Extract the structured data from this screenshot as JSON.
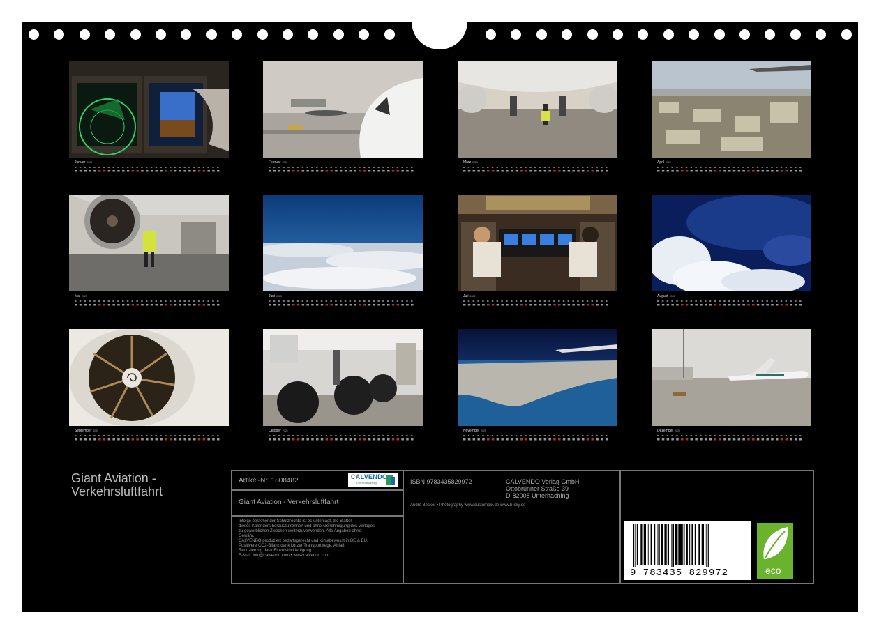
{
  "calendar": {
    "year": "2025",
    "months": [
      {
        "name": "Januar",
        "scene": "cockpit-displays"
      },
      {
        "name": "Februar",
        "scene": "airport-nose"
      },
      {
        "name": "März",
        "scene": "under-aircraft"
      },
      {
        "name": "April",
        "scene": "city-aerial"
      },
      {
        "name": "Mai",
        "scene": "engine-apron"
      },
      {
        "name": "Juni",
        "scene": "above-clouds"
      },
      {
        "name": "Juli",
        "scene": "cockpit-pilots"
      },
      {
        "name": "August",
        "scene": "cumulus"
      },
      {
        "name": "September",
        "scene": "engine-fan"
      },
      {
        "name": "Oktober",
        "scene": "landing-gear"
      },
      {
        "name": "November",
        "scene": "coast-from-altitude"
      },
      {
        "name": "Dezember",
        "scene": "apron-747"
      }
    ]
  },
  "product": {
    "title_line1": "Giant Aviation -",
    "title_line2": "Verkehrsluftfahrt"
  },
  "info": {
    "article": "Artikel-Nr. 1808482",
    "calvendo_logo": "CALVENDO",
    "calvendo_sub": "Der Kunstverlag",
    "subtitle": "Giant Aviation - Verkehrsluftfahrt",
    "legal_lines": [
      "Infolge bestehender Schutzrechte ist es untersagt, die Blätter",
      "dieses Kalenders herauszutrennen und ohne Genehmigung des Verlages",
      "zu gewerblichen Zwecken weiterzuverwenden. Alle Angaben ohne",
      "Gewähr.",
      "CALVENDO produziert bedarfsgerecht und klimabewusst in DE & EU.",
      "Positivere CO2-Bilanz dank kurzer Transportwege, Abfall-",
      "Reduzierung dank Einzelstückfertigung.",
      "E-Mail: info@calvendo.com • www.calvendo.com"
    ],
    "isbn": "ISBN 9783435829972",
    "publisher_lines": [
      "CALVENDO Verlag GmbH",
      "Ottobrunner Straße 39",
      "D-82008 Unterhaching"
    ],
    "credit": "André Becker • Photography www.custompix.de www.b-sky.de",
    "barcode_text": "9 783435 829972",
    "barcode_digits": "9783435829972",
    "eco_label": "eco"
  },
  "colors": {
    "sheet": "#000000",
    "border_lines": "#777777",
    "text_gray": "#999999",
    "eco_green": "#6ab42d"
  }
}
